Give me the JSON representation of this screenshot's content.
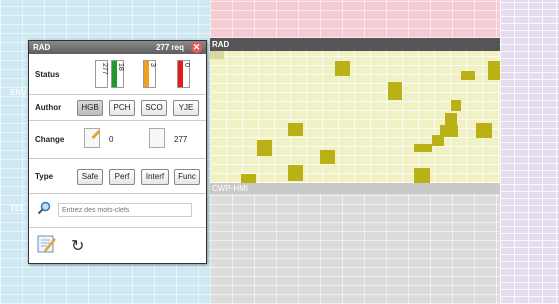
{
  "background": {
    "left_label_1": "ENV",
    "left_label_2": "TEL",
    "rad_block_title": "RAD",
    "cwp_block_title": "CWP-HMI"
  },
  "panel": {
    "title": "RAD",
    "request_count": "277 req",
    "status": {
      "label": "Status",
      "bars": [
        {
          "value": "277",
          "color": "#ffffff"
        },
        {
          "value": "18",
          "color": "#1e9a2c"
        },
        {
          "value": "3",
          "color": "#f0a020"
        },
        {
          "value": "0",
          "color": "#e01c1c"
        }
      ]
    },
    "author": {
      "label": "Author",
      "options": [
        "HGB",
        "PCH",
        "SCO",
        "YJE"
      ],
      "active": "HGB"
    },
    "change": {
      "label": "Change",
      "modified_count": "0",
      "unmodified_count": "277"
    },
    "type": {
      "label": "Type",
      "options": [
        "Safe",
        "Perf",
        "Interf",
        "Func"
      ]
    },
    "search": {
      "placeholder": "Entrez des mots-clefs"
    },
    "icons": {
      "close": "close-icon",
      "search": "search-icon",
      "edit": "edit-icon",
      "refresh": "refresh-icon"
    }
  },
  "colors": {
    "highlight_cell": "#b9b116",
    "rad_block_bg": "#f1f1c6"
  }
}
